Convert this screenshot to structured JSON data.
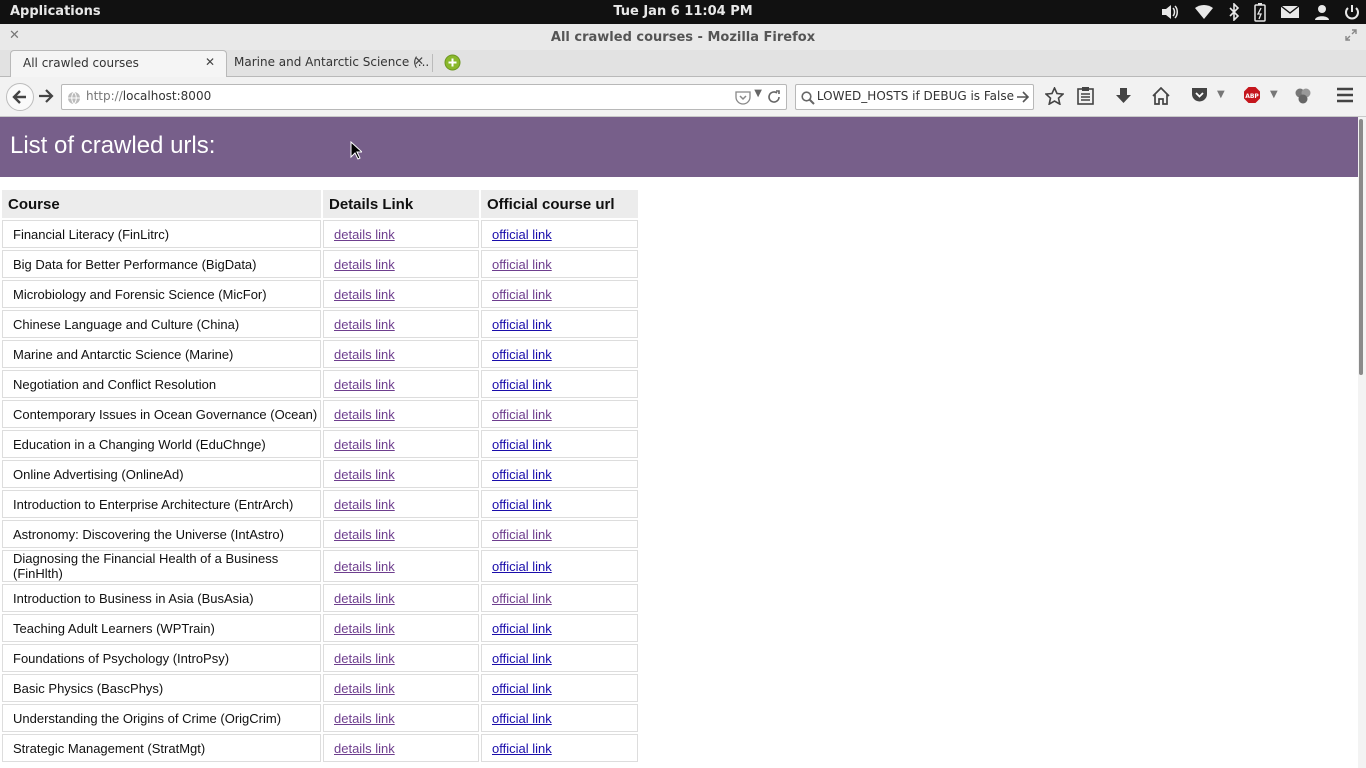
{
  "system_bar": {
    "applications": "Applications",
    "clock": "Tue Jan  6 11:04 PM"
  },
  "window": {
    "title": "All crawled courses - Mozilla Firefox"
  },
  "tabs": [
    {
      "label": "All crawled courses",
      "active": true
    },
    {
      "label": "Marine and Antarctic Science (...",
      "active": false
    }
  ],
  "navbar": {
    "url_prefix": "http://",
    "url_host": "localhost:8000",
    "search_text": "ettings.ALLOWED_HOSTS if DEBUG is False"
  },
  "page": {
    "heading": "List of crawled urls:",
    "banner_color": "#775f8a",
    "table": {
      "headers": [
        "Course",
        "Details Link",
        "Official course url"
      ],
      "details_label": "details link",
      "official_label": "official link",
      "rows": [
        {
          "course": "Financial Literacy (FinLitrc)",
          "details": "details link",
          "official": "official link",
          "official_visited": false
        },
        {
          "course": "Big Data for Better Performance (BigData)",
          "details": "details link",
          "official": "official link",
          "official_visited": true
        },
        {
          "course": "Microbiology and Forensic Science (MicFor)",
          "details": "details link",
          "official": "official link",
          "official_visited": true
        },
        {
          "course": "Chinese Language and Culture (China)",
          "details": "details link",
          "official": "official link",
          "official_visited": false
        },
        {
          "course": "Marine and Antarctic Science (Marine)",
          "details": "details link",
          "official": "official link",
          "official_visited": false
        },
        {
          "course": "Negotiation and Conflict Resolution",
          "details": "details link",
          "official": "official link",
          "official_visited": false
        },
        {
          "course": "Contemporary Issues in Ocean Governance (Ocean)",
          "details": "details link",
          "official": "official link",
          "official_visited": true
        },
        {
          "course": "Education in a Changing World (EduChnge)",
          "details": "details link",
          "official": "official link",
          "official_visited": false
        },
        {
          "course": "Online Advertising (OnlineAd)",
          "details": "details link",
          "official": "official link",
          "official_visited": false
        },
        {
          "course": "Introduction to Enterprise Architecture (EntrArch)",
          "details": "details link",
          "official": "official link",
          "official_visited": false
        },
        {
          "course": "Astronomy: Discovering the Universe (IntAstro)",
          "details": "details link",
          "official": "official link",
          "official_visited": true
        },
        {
          "course": "Diagnosing the Financial Health of a Business (FinHlth)",
          "details": "details link",
          "official": "official link",
          "official_visited": false
        },
        {
          "course": "Introduction to Business in Asia (BusAsia)",
          "details": "details link",
          "official": "official link",
          "official_visited": true
        },
        {
          "course": "Teaching Adult Learners (WPTrain)",
          "details": "details link",
          "official": "official link",
          "official_visited": false
        },
        {
          "course": "Foundations of Psychology (IntroPsy)",
          "details": "details link",
          "official": "official link",
          "official_visited": false
        },
        {
          "course": "Basic Physics (BascPhys)",
          "details": "details link",
          "official": "official link",
          "official_visited": false
        },
        {
          "course": "Understanding the Origins of Crime (OrigCrim)",
          "details": "details link",
          "official": "official link",
          "official_visited": false
        },
        {
          "course": "Strategic Management (StratMgt)",
          "details": "details link",
          "official": "official link",
          "official_visited": false
        }
      ]
    }
  },
  "icons": {
    "volume": "volume-icon",
    "wifi": "wifi-icon",
    "bluetooth": "bluetooth-icon",
    "battery": "battery-icon",
    "mail": "mail-icon",
    "user": "user-icon",
    "power": "power-icon"
  }
}
